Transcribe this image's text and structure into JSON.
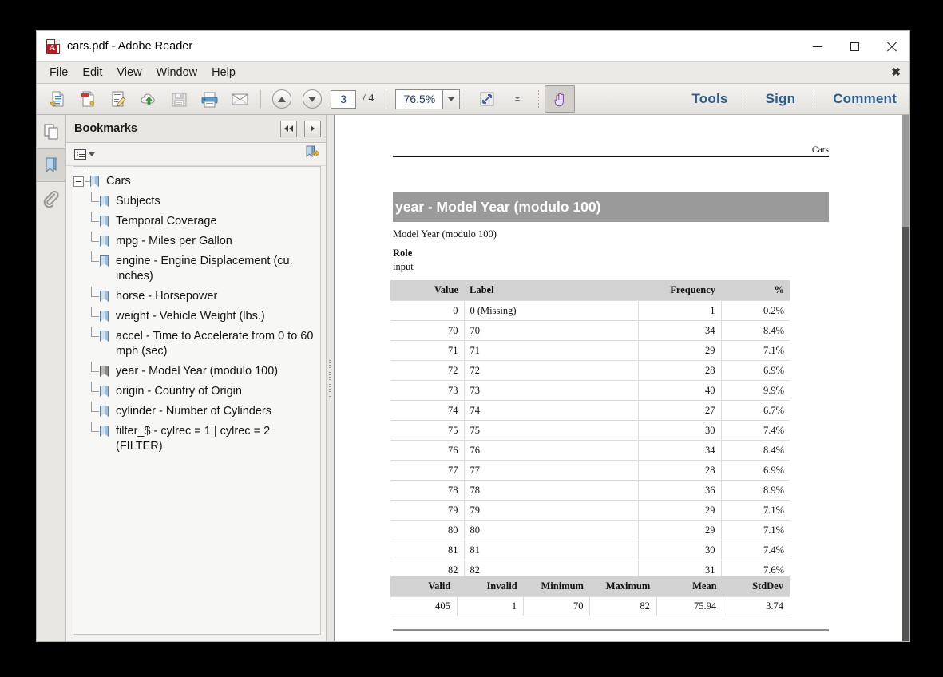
{
  "window": {
    "title": "cars.pdf - Adobe Reader",
    "app_icon": "pdf-file-icon",
    "minimize": "–",
    "maximize": "□",
    "close": "✕"
  },
  "menu": {
    "items": [
      "File",
      "Edit",
      "View",
      "Window",
      "Help"
    ],
    "close_doc": "✖"
  },
  "toolbar": {
    "buttons": [
      {
        "name": "open-previous-icon",
        "label": ""
      },
      {
        "name": "create-pdf-icon",
        "label": ""
      },
      {
        "name": "edit-pdf-icon",
        "label": ""
      },
      {
        "name": "upload-cloud-icon",
        "label": ""
      },
      {
        "name": "save-icon",
        "label": ""
      },
      {
        "name": "print-icon",
        "label": ""
      },
      {
        "name": "email-icon",
        "label": ""
      }
    ],
    "page_current": "3",
    "page_total": "/ 4",
    "zoom_value": "76.5%",
    "hand_tool": "hand-tool-icon",
    "links": [
      "Tools",
      "Sign",
      "Comment"
    ]
  },
  "rail": {
    "items": [
      {
        "name": "page-thumbnails-icon",
        "selected": false
      },
      {
        "name": "bookmarks-icon",
        "selected": true
      },
      {
        "name": "attachments-icon",
        "selected": false
      }
    ]
  },
  "nav_panel": {
    "title": "Bookmarks",
    "collapse_button": "◀◀",
    "expand_button": "▶",
    "options_button": "bookmark-options-icon",
    "new_bookmark_button": "new-bookmark-icon",
    "bookmarks": [
      {
        "label": "Cars",
        "level": 0,
        "expanded": true,
        "current": false
      },
      {
        "label": "Subjects",
        "level": 1,
        "current": false
      },
      {
        "label": "Temporal Coverage",
        "level": 1,
        "current": false
      },
      {
        "label": "mpg - Miles per Gallon",
        "level": 1,
        "current": false
      },
      {
        "label": "engine - Engine Displacement (cu. inches)",
        "level": 1,
        "current": false
      },
      {
        "label": "horse - Horsepower",
        "level": 1,
        "current": false
      },
      {
        "label": "weight - Vehicle Weight (lbs.)",
        "level": 1,
        "current": false
      },
      {
        "label": "accel - Time to Accelerate from 0 to 60 mph (sec)",
        "level": 1,
        "current": false
      },
      {
        "label": "year - Model Year (modulo 100)",
        "level": 1,
        "current": true
      },
      {
        "label": "origin - Country of Origin",
        "level": 1,
        "current": false
      },
      {
        "label": "cylinder - Number of Cylinders",
        "level": 1,
        "current": false
      },
      {
        "label": "filter_$ - cylrec = 1 | cylrec = 2 (FILTER)",
        "level": 1,
        "current": false
      }
    ]
  },
  "document": {
    "running_header": "Cars",
    "section_title": "year - Model Year (modulo 100)",
    "description": "Model Year (modulo 100)",
    "role_label": "Role",
    "role_value": "input",
    "freq_table": {
      "headers": [
        "Value",
        "Label",
        "Frequency",
        "%"
      ],
      "rows": [
        [
          "0",
          "0 (Missing)",
          "1",
          "0.2%"
        ],
        [
          "70",
          "70",
          "34",
          "8.4%"
        ],
        [
          "71",
          "71",
          "29",
          "7.1%"
        ],
        [
          "72",
          "72",
          "28",
          "6.9%"
        ],
        [
          "73",
          "73",
          "40",
          "9.9%"
        ],
        [
          "74",
          "74",
          "27",
          "6.7%"
        ],
        [
          "75",
          "75",
          "30",
          "7.4%"
        ],
        [
          "76",
          "76",
          "34",
          "8.4%"
        ],
        [
          "77",
          "77",
          "28",
          "6.9%"
        ],
        [
          "78",
          "78",
          "36",
          "8.9%"
        ],
        [
          "79",
          "79",
          "29",
          "7.1%"
        ],
        [
          "80",
          "80",
          "29",
          "7.1%"
        ],
        [
          "81",
          "81",
          "30",
          "7.4%"
        ],
        [
          "82",
          "82",
          "31",
          "7.6%"
        ]
      ]
    },
    "summary_table": {
      "headers": [
        "Valid",
        "Invalid",
        "Minimum",
        "Maximum",
        "Mean",
        "StdDev"
      ],
      "row": [
        "405",
        "1",
        "70",
        "82",
        "75.94",
        "3.74"
      ]
    }
  },
  "colors": {
    "section_bar": "#9a9a9a",
    "table_header": "#d2d2d2",
    "toolbar_link": "#2b5c8a",
    "viewer_bg": "#555452"
  }
}
